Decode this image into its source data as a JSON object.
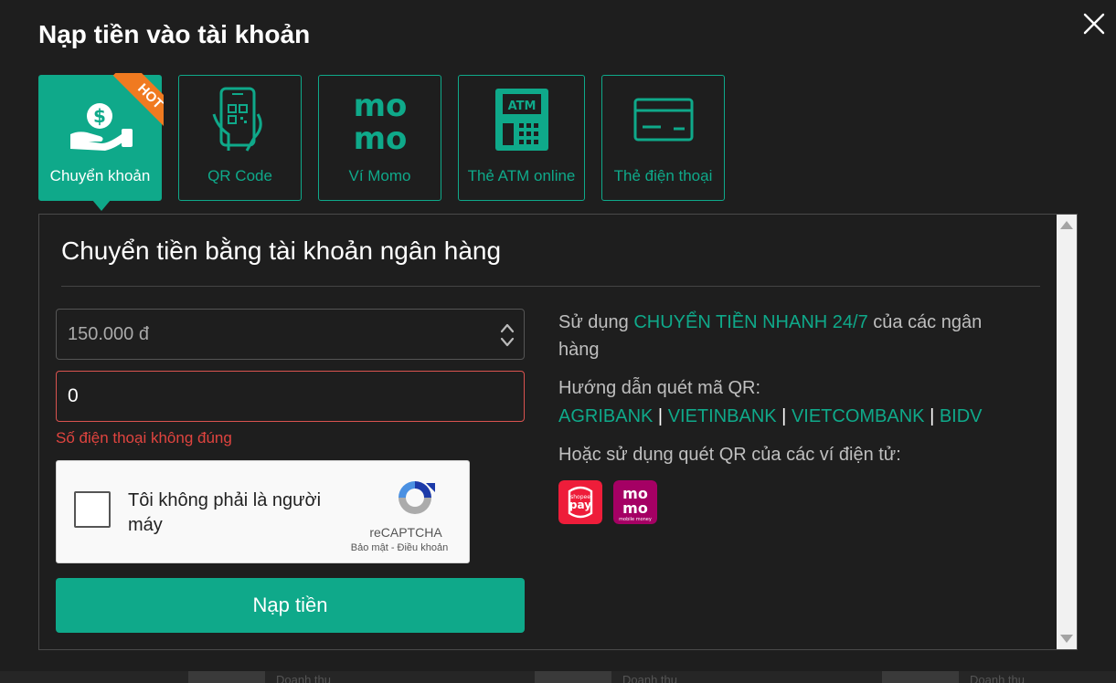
{
  "modal": {
    "title": "Nạp tiền vào tài khoản",
    "close_icon": "close-icon"
  },
  "tabs": [
    {
      "label": "Chuyển khoản",
      "icon": "hand-money-icon",
      "active": true,
      "badge": "HOT"
    },
    {
      "label": "QR Code",
      "icon": "phone-qr-icon",
      "active": false
    },
    {
      "label": "Ví Momo",
      "icon": "momo-icon",
      "active": false
    },
    {
      "label": "Thẻ ATM online",
      "icon": "atm-icon",
      "active": false
    },
    {
      "label": "Thẻ điện thoại",
      "icon": "card-icon",
      "active": false
    }
  ],
  "panel": {
    "title": "Chuyển tiền bằng tài khoản ngân hàng",
    "amount_value": "150.000 đ",
    "phone_value": "0",
    "phone_error": "Số điện thoại không đúng",
    "captcha": {
      "label": "Tôi không phải là người máy",
      "brand": "reCAPTCHA",
      "privacy": "Bảo mật",
      "separator": " - ",
      "terms": "Điều khoản"
    },
    "submit_label": "Nạp tiền",
    "info": {
      "line1_prefix": "Sử dụng ",
      "line1_highlight": "CHUYỂN TIỀN NHANH 24/7",
      "line1_suffix": " của các ngân hàng",
      "guide_label": "Hướng dẫn quét mã QR:",
      "banks": [
        "AGRIBANK",
        "VIETINBANK",
        "VIETCOMBANK",
        "BIDV"
      ],
      "bank_separator": "|",
      "wallets_label": "Hoặc sử dụng quét QR của các ví điện tử:",
      "wallets": [
        {
          "name": "ShopeePay",
          "icon": "shopeepay-icon",
          "color": "#ee1d3a",
          "text": "pay",
          "subtext": "shopee"
        },
        {
          "name": "MoMo",
          "icon": "momo-wallet-icon",
          "color": "#a50064",
          "text": "mo",
          "subtext": "mobile money"
        }
      ]
    }
  },
  "colors": {
    "accent": "#0fa98a",
    "hot": "#f07a20",
    "error": "#e0443f",
    "background": "#1e1e1e"
  },
  "background_strip": [
    "Doanh thu",
    "Doanh thu",
    "Doanh thu"
  ]
}
